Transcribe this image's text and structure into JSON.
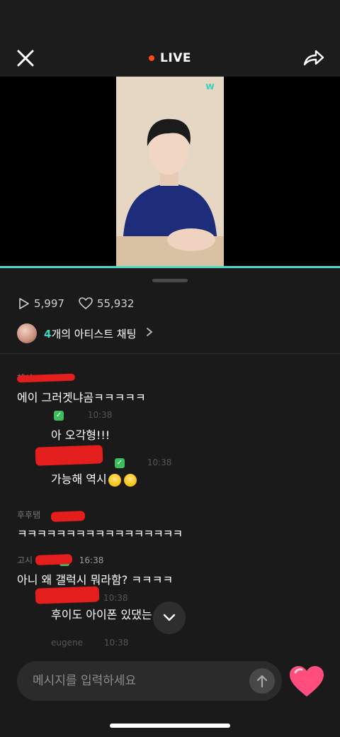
{
  "header": {
    "live_label": "LIVE",
    "close_icon": "close-icon",
    "share_icon": "share-icon"
  },
  "video": {
    "watermark": "w"
  },
  "stats": {
    "plays": "5,997",
    "likes": "55,932"
  },
  "artist_chat": {
    "count": "4",
    "label": "개의 아티스트 채팅"
  },
  "chat": {
    "messages": [
      {
        "meta": "헤시",
        "text": "에이 그러겟냐곰ㅋㅋㅋㅋㅋ"
      },
      {
        "meta": "10:38",
        "text": "아 오각형!!!"
      },
      {
        "meta": "10:38",
        "text": "가능해 역시"
      },
      {
        "meta": "후후탬",
        "text": "ㅋㅋㅋㅋㅋㅋㅋㅋㅋㅋㅋㅋㅋㅋㅋㅋㅋ"
      },
      {
        "meta": "16:38",
        "text": "아니 왜 갤럭시 뭐라함? ㅋㅋㅋㅋ"
      },
      {
        "meta": "10:38",
        "text": "후이도 아이폰 있댔는ㅋㅋㅋ"
      },
      {
        "meta": "eugene",
        "meta2": "10:38"
      }
    ]
  },
  "composer": {
    "placeholder": "메시지를 입력하세요"
  },
  "colors": {
    "accent": "#3fd4b8",
    "live_dot": "#ff4a1c",
    "heart": "#ff4d7d"
  }
}
